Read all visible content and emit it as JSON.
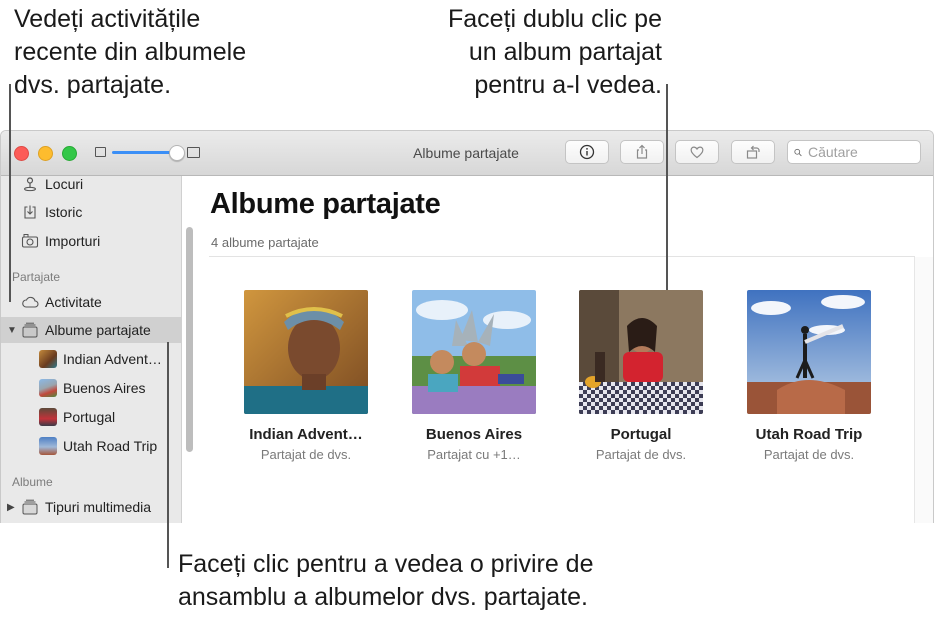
{
  "callouts": {
    "top_left": "Vedeți activitățile\nrecente din albumele\ndvs. partajate.",
    "top_right": "Faceți dublu clic pe\nun album partajat\npentru a-l vedea.",
    "bottom": "Faceți clic pentru a vedea o privire de\nansamblu a albumelor dvs. partajate."
  },
  "window": {
    "title": "Albume partajate",
    "search_placeholder": "Căutare"
  },
  "toolbar": {
    "icons": [
      "info-icon",
      "share-icon",
      "heart-icon",
      "rotate-icon"
    ]
  },
  "sidebar": {
    "top_items": [
      {
        "label": "Locuri",
        "icon": "pin-icon"
      },
      {
        "label": "Istoric",
        "icon": "import-history-icon"
      },
      {
        "label": "Importuri",
        "icon": "camera-icon"
      }
    ],
    "section_shared": "Partajate",
    "activity": "Activitate",
    "shared_albums": "Albume partajate",
    "albums": [
      {
        "label": "Indian Advent…"
      },
      {
        "label": "Buenos Aires"
      },
      {
        "label": "Portugal"
      },
      {
        "label": "Utah Road Trip"
      }
    ],
    "section_albums": "Albume",
    "media_types": "Tipuri multimedia"
  },
  "main": {
    "heading": "Albume partajate",
    "count": "4 albume partajate",
    "albums": [
      {
        "name": "Indian Advent…",
        "sub": "Partajat de dvs."
      },
      {
        "name": "Buenos Aires",
        "sub": "Partajat cu +1…"
      },
      {
        "name": "Portugal",
        "sub": "Partajat de dvs."
      },
      {
        "name": "Utah Road Trip",
        "sub": "Partajat de dvs."
      }
    ]
  },
  "colors": {
    "slider_accent": "#3b8ff6",
    "sidebar_bg": "#e9e9e9",
    "selection_bg": "#d0d0d0"
  }
}
